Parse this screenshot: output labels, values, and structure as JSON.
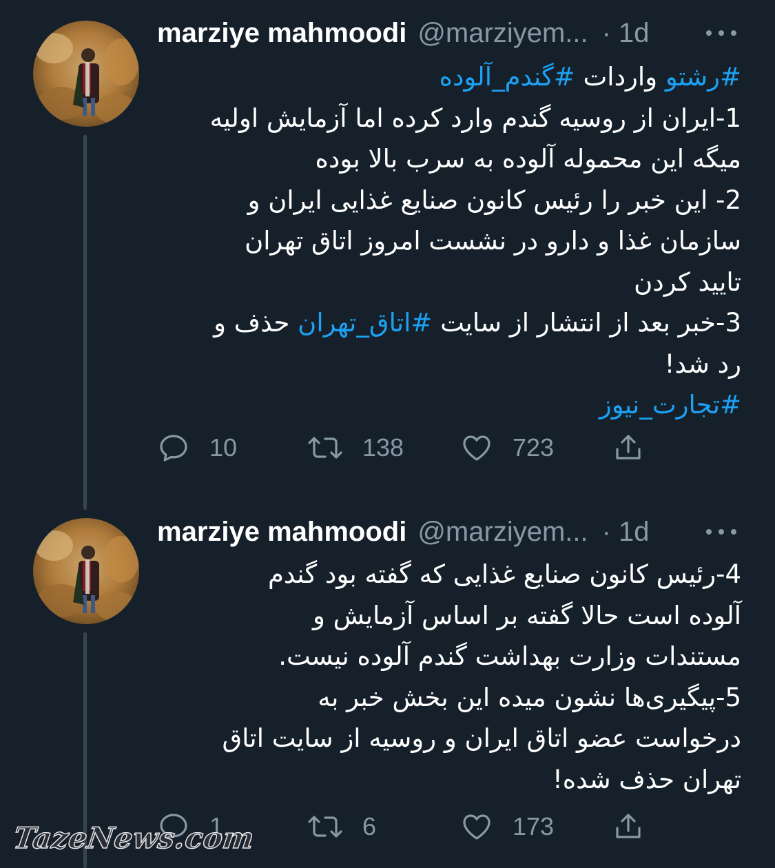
{
  "colors": {
    "background": "#15202b",
    "primary_text": "#ffffff",
    "secondary_text": "#8899a6",
    "hashtag": "#1da1f2",
    "thread_line": "#38444d"
  },
  "tweets": [
    {
      "author": {
        "name": "marziye mahmoodi",
        "handle": "@marziyem...",
        "avatar": "avatar-photo"
      },
      "time": "· 1d",
      "more_icon": "more-icon",
      "lines": [
        [
          {
            "text": "#رشتو",
            "hashtag": true
          },
          {
            "text": " واردات ",
            "hashtag": false
          },
          {
            "text": "#گندم_آلوده",
            "hashtag": true
          }
        ],
        [
          {
            "text": "1-ایران از روسیه گندم وارد کرده اما آزمایش اولیه",
            "hashtag": false
          }
        ],
        [
          {
            "text": "میگه این محموله آلوده به سرب بالا بوده",
            "hashtag": false
          }
        ],
        [
          {
            "text": "2- این خبر را رئیس کانون صنایع غذایی ایران و",
            "hashtag": false
          }
        ],
        [
          {
            "text": "سازمان غذا و دارو در نشست امروز اتاق تهران",
            "hashtag": false
          }
        ],
        [
          {
            "text": "تایید کردن",
            "hashtag": false
          }
        ],
        [
          {
            "text": "3-خبر بعد از انتشار از سایت ",
            "hashtag": false
          },
          {
            "text": "#اتاق_تهران",
            "hashtag": true
          },
          {
            "text": " حذف و",
            "hashtag": false
          }
        ],
        [
          {
            "text": "رد شد!",
            "hashtag": false
          }
        ],
        [
          {
            "text": "#تجارت_نیوز",
            "hashtag": true
          }
        ]
      ],
      "actions": {
        "reply": {
          "icon": "reply-icon",
          "count": "10"
        },
        "retweet": {
          "icon": "retweet-icon",
          "count": "138"
        },
        "like": {
          "icon": "heart-icon",
          "count": "723"
        },
        "share": {
          "icon": "share-icon"
        }
      }
    },
    {
      "author": {
        "name": "marziye mahmoodi",
        "handle": "@marziyem...",
        "avatar": "avatar-photo"
      },
      "time": "· 1d",
      "more_icon": "more-icon",
      "lines": [
        [
          {
            "text": "4-رئیس کانون صنایع غذایی که گفته بود گندم",
            "hashtag": false
          }
        ],
        [
          {
            "text": "آلوده است حالا گفته بر اساس آزمایش و",
            "hashtag": false
          }
        ],
        [
          {
            "text": "مستندات وزارت بهداشت گندم آلوده نیست.",
            "hashtag": false
          }
        ],
        [
          {
            "text": "5-پیگیری‌ها نشون میده این بخش خبر به",
            "hashtag": false
          }
        ],
        [
          {
            "text": "درخواست عضو اتاق ایران و روسیه از سایت اتاق",
            "hashtag": false
          }
        ],
        [
          {
            "text": "تهران حذف شده!",
            "hashtag": false
          }
        ]
      ],
      "actions": {
        "reply": {
          "icon": "reply-icon",
          "count": "1"
        },
        "retweet": {
          "icon": "retweet-icon",
          "count": "6"
        },
        "like": {
          "icon": "heart-icon",
          "count": "173"
        },
        "share": {
          "icon": "share-icon"
        }
      }
    }
  ],
  "watermark": {
    "text": "TazeNews.com"
  }
}
